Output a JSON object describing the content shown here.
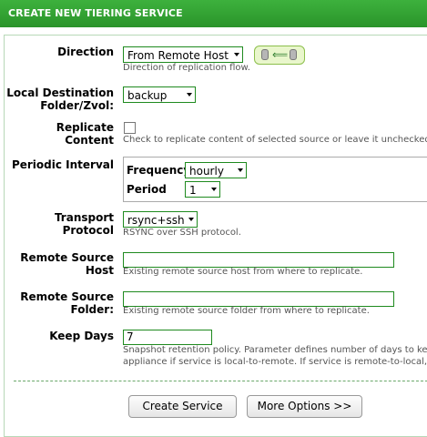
{
  "header": {
    "title": "CREATE NEW TIERING SERVICE"
  },
  "direction": {
    "label": "Direction",
    "value": "From Remote Host",
    "hint": "Direction of replication flow.",
    "icon": "arrow-left"
  },
  "local_dest": {
    "label": "Local Destination Folder/Zvol:",
    "value": "backup"
  },
  "replicate": {
    "label": "Replicate Content",
    "checked": false,
    "hint": "Check to replicate content of selected source or leave it unchecked to"
  },
  "periodic": {
    "label": "Periodic Interval",
    "frequency_label": "Frequency",
    "frequency_value": "hourly",
    "period_label": "Period",
    "period_value": "1"
  },
  "transport": {
    "label": "Transport Protocol",
    "value": "rsync+ssh",
    "hint": "RSYNC over SSH protocol."
  },
  "remote_host": {
    "label": "Remote Source Host",
    "value": "",
    "hint": "Existing remote source host from where to replicate."
  },
  "remote_folder": {
    "label": "Remote Source Folder:",
    "value": "",
    "hint": "Existing remote source folder from where to replicate."
  },
  "keep_days": {
    "label": "Keep Days",
    "value": "7",
    "hint_line1": "Snapshot retention policy. Parameter defines number of days to keep",
    "hint_line2": "appliance if service is local-to-remote. If service is remote-to-local, loc"
  },
  "buttons": {
    "create": "Create Service",
    "more": "More Options >>"
  }
}
